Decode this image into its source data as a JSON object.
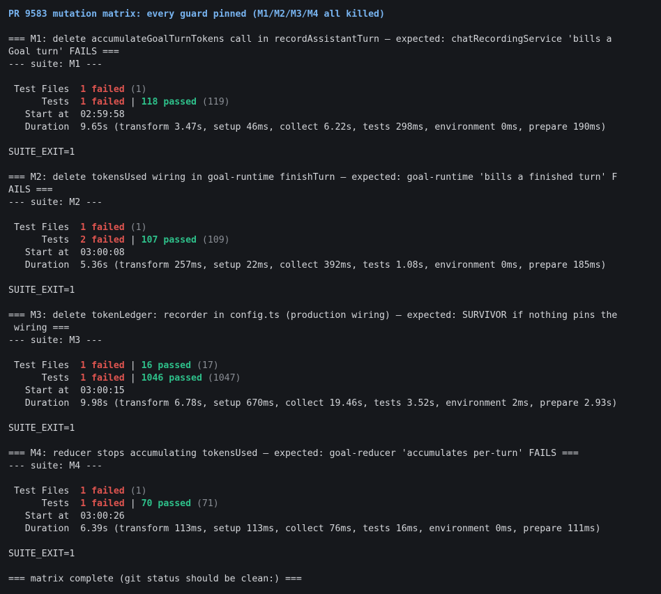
{
  "title": "PR 9583 mutation matrix: every guard pinned (M1/M2/M3/M4 all killed)",
  "labels": {
    "test_files": " Test Files  ",
    "tests": "      Tests  ",
    "start_at": "   Start at  ",
    "duration": "   Duration  "
  },
  "m1": {
    "header_1": "=== M1: delete accumulateGoalTurnTokens call in recordAssistantTurn — expected: chatRecordingService 'bills a",
    "header_2": "Goal turn' FAILS ===",
    "suite": "--- suite: M1 ---",
    "files_failed": "1 failed",
    "files_total": " (1)",
    "tests_failed": "1 failed",
    "tests_passed": "118 passed",
    "tests_total": " (119)",
    "start": "02:59:58",
    "duration": "9.65s (transform 3.47s, setup 46ms, collect 6.22s, tests 298ms, environment 0ms, prepare 190ms)",
    "exit": "SUITE_EXIT=1"
  },
  "m2": {
    "header_1": "=== M2: delete tokensUsed wiring in goal-runtime finishTurn — expected: goal-runtime 'bills a finished turn' F",
    "header_2": "AILS ===",
    "suite": "--- suite: M2 ---",
    "files_failed": "1 failed",
    "files_total": " (1)",
    "tests_failed": "2 failed",
    "tests_passed": "107 passed",
    "tests_total": " (109)",
    "start": "03:00:08",
    "duration": "5.36s (transform 257ms, setup 22ms, collect 392ms, tests 1.08s, environment 0ms, prepare 185ms)",
    "exit": "SUITE_EXIT=1"
  },
  "m3": {
    "header_1": "=== M3: delete tokenLedger: recorder in config.ts (production wiring) — expected: SURVIVOR if nothing pins the",
    "header_2": " wiring ===",
    "suite": "--- suite: M3 ---",
    "files_failed": "1 failed",
    "files_passed": "16 passed",
    "files_total": " (17)",
    "tests_failed": "1 failed",
    "tests_passed": "1046 passed",
    "tests_total": " (1047)",
    "start": "03:00:15",
    "duration": "9.98s (transform 6.78s, setup 670ms, collect 19.46s, tests 3.52s, environment 2ms, prepare 2.93s)",
    "exit": "SUITE_EXIT=1"
  },
  "m4": {
    "header_1": "=== M4: reducer stops accumulating tokensUsed — expected: goal-reducer 'accumulates per-turn' FAILS ===",
    "suite": "--- suite: M4 ---",
    "files_failed": "1 failed",
    "files_total": " (1)",
    "tests_failed": "1 failed",
    "tests_passed": "70 passed",
    "tests_total": " (71)",
    "start": "03:00:26",
    "duration": "6.39s (transform 113ms, setup 113ms, collect 76ms, tests 16ms, environment 0ms, prepare 111ms)",
    "exit": "SUITE_EXIT=1"
  },
  "footer": "=== matrix complete (git status should be clean:) ===",
  "separator": " | ",
  "colors": {
    "background": "#16181c",
    "text": "#d4d6da",
    "title": "#78b4f0",
    "failed": "#e05550",
    "passed": "#2ec08a",
    "dim": "#8a8e95"
  }
}
